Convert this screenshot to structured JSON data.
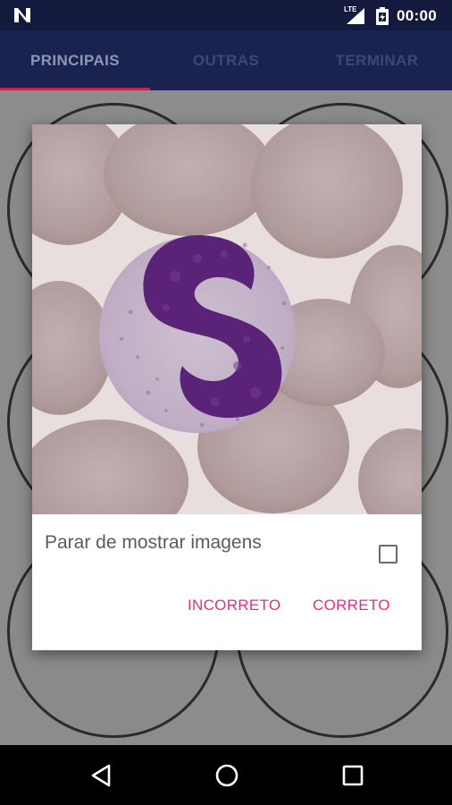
{
  "status_bar": {
    "network_label": "LTE",
    "time": "00:00",
    "icons": [
      "n-logo-icon",
      "signal-icon",
      "battery-icon"
    ]
  },
  "tabs": [
    {
      "label": "PRINCIPAIS",
      "active": true
    },
    {
      "label": "OUTRAS",
      "active": false
    },
    {
      "label": "TERMINAR",
      "active": false
    }
  ],
  "dialog": {
    "image_subject": "blood smear cell image",
    "checkbox_label": "Parar de mostrar imagens",
    "checkbox_checked": false,
    "buttons": {
      "incorrect": "INCORRETO",
      "correct": "CORRETO"
    }
  },
  "nav_bar": {
    "icons": [
      "back-icon",
      "home-icon",
      "recents-icon"
    ]
  },
  "colors": {
    "status_bar_bg": "#141a3d",
    "tab_bar_bg": "#1a224f",
    "tab_indicator": "#c4294b",
    "accent_buttons": "#e52e7b"
  }
}
